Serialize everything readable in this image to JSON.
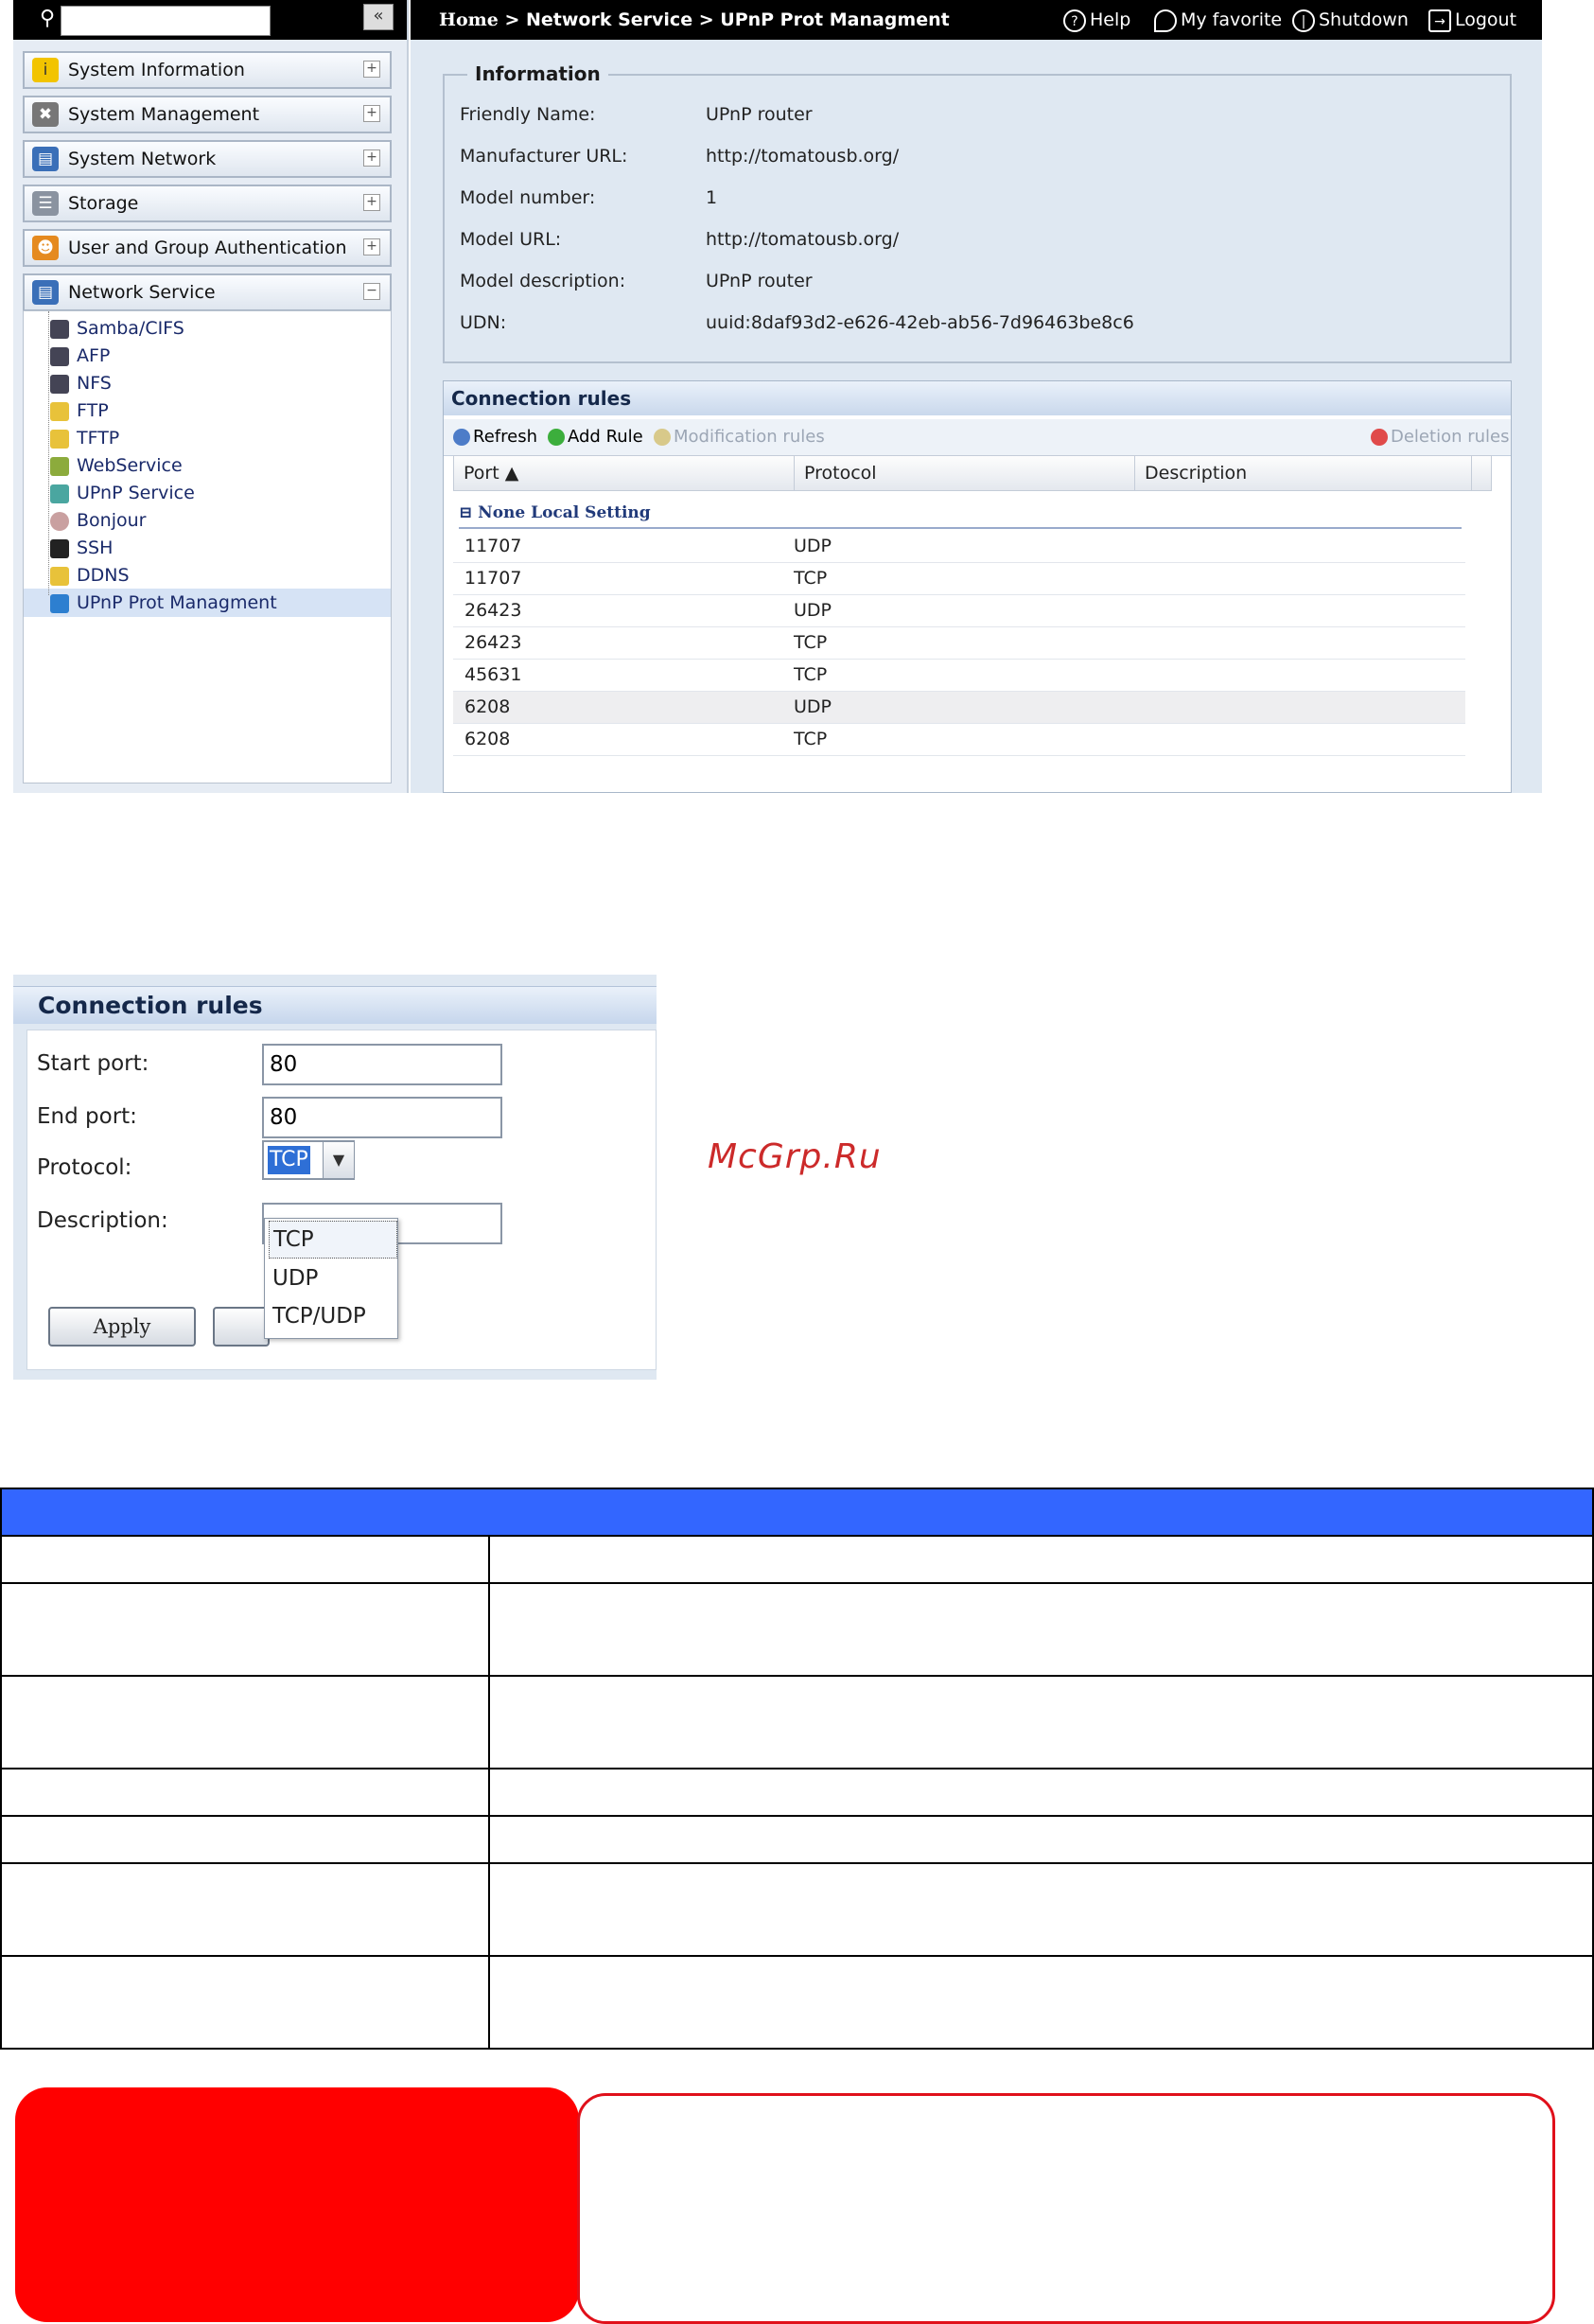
{
  "sidebar": {
    "collapse_label": "«",
    "sections": [
      {
        "label": "System Information",
        "icon": "info-icon",
        "toggle": "+"
      },
      {
        "label": "System Management",
        "icon": "tools-icon",
        "toggle": "+"
      },
      {
        "label": "System Network",
        "icon": "network-icon",
        "toggle": "+"
      },
      {
        "label": "Storage",
        "icon": "storage-icon",
        "toggle": "+"
      },
      {
        "label": "User and Group Authentication",
        "icon": "users-icon",
        "toggle": "+"
      },
      {
        "label": "Network Service",
        "icon": "network-service-icon",
        "toggle": "−"
      }
    ],
    "tree": [
      {
        "label": "Samba/CIFS"
      },
      {
        "label": "AFP"
      },
      {
        "label": "NFS"
      },
      {
        "label": "FTP"
      },
      {
        "label": "TFTP"
      },
      {
        "label": "WebService"
      },
      {
        "label": "UPnP Service"
      },
      {
        "label": "Bonjour"
      },
      {
        "label": "SSH"
      },
      {
        "label": "DDNS"
      },
      {
        "label": "UPnP Prot Managment",
        "selected": true
      }
    ]
  },
  "header": {
    "home": "Home",
    "sep1": ">",
    "crumb1": "Network Service",
    "sep2": ">",
    "crumb2": "UPnP Prot Managment",
    "help": "Help",
    "favorite": "My favorite",
    "shutdown": "Shutdown",
    "logout": "Logout"
  },
  "information": {
    "legend": "Information",
    "rows": [
      {
        "label": "Friendly Name:",
        "value": "UPnP router"
      },
      {
        "label": "Manufacturer URL:",
        "value": "http://tomatousb.org/"
      },
      {
        "label": "Model number:",
        "value": "1"
      },
      {
        "label": "Model URL:",
        "value": "http://tomatousb.org/"
      },
      {
        "label": "Model description:",
        "value": "UPnP router"
      },
      {
        "label": "UDN:",
        "value": "uuid:8daf93d2-e626-42eb-ab56-7d96463be8c6"
      }
    ]
  },
  "connection_rules": {
    "title": "Connection rules",
    "toolbar": {
      "refresh": "Refresh",
      "add_rule": "Add Rule",
      "modification": "Modification rules",
      "deletion": "Deletion rules"
    },
    "columns": {
      "port": "Port ▲",
      "protocol": "Protocol",
      "description": "Description"
    },
    "group": "None Local Setting",
    "rows": [
      {
        "port": "11707",
        "protocol": "UDP"
      },
      {
        "port": "11707",
        "protocol": "TCP"
      },
      {
        "port": "26423",
        "protocol": "UDP"
      },
      {
        "port": "26423",
        "protocol": "TCP"
      },
      {
        "port": "45631",
        "protocol": "TCP"
      },
      {
        "port": "6208",
        "protocol": "UDP"
      },
      {
        "port": "6208",
        "protocol": "TCP"
      }
    ]
  },
  "rule_form": {
    "title": "Connection rules",
    "start_port_label": "Start port:",
    "start_port_value": "80",
    "end_port_label": "End port:",
    "end_port_value": "80",
    "protocol_label": "Protocol:",
    "protocol_value": "TCP",
    "description_label": "Description:",
    "options": [
      "TCP",
      "UDP",
      "TCP/UDP"
    ],
    "apply_label": "Apply"
  },
  "watermark": "McGrp.Ru",
  "colors": {
    "table_header": "#3366ff",
    "note_red": "#ff0000"
  }
}
